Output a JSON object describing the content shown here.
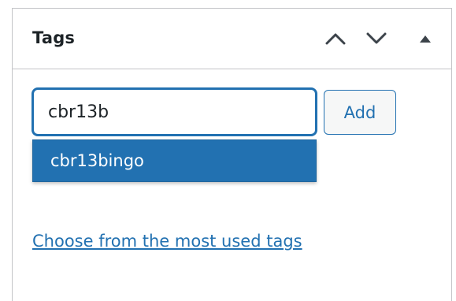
{
  "panel": {
    "title": "Tags",
    "controls": {
      "move_up_icon": "chevron-up-icon",
      "move_down_icon": "chevron-down-icon",
      "toggle_icon": "caret-up-icon"
    }
  },
  "tag_form": {
    "input_value": "cbr13b",
    "add_label": "Add",
    "suggestions": [
      {
        "label": "cbr13bingo"
      }
    ]
  },
  "most_used_link": "Choose from the most used tags",
  "colors": {
    "accent": "#2271b1",
    "text": "#1d2327",
    "border": "#c3c4c7",
    "suggestion_text": "#ffffff"
  }
}
